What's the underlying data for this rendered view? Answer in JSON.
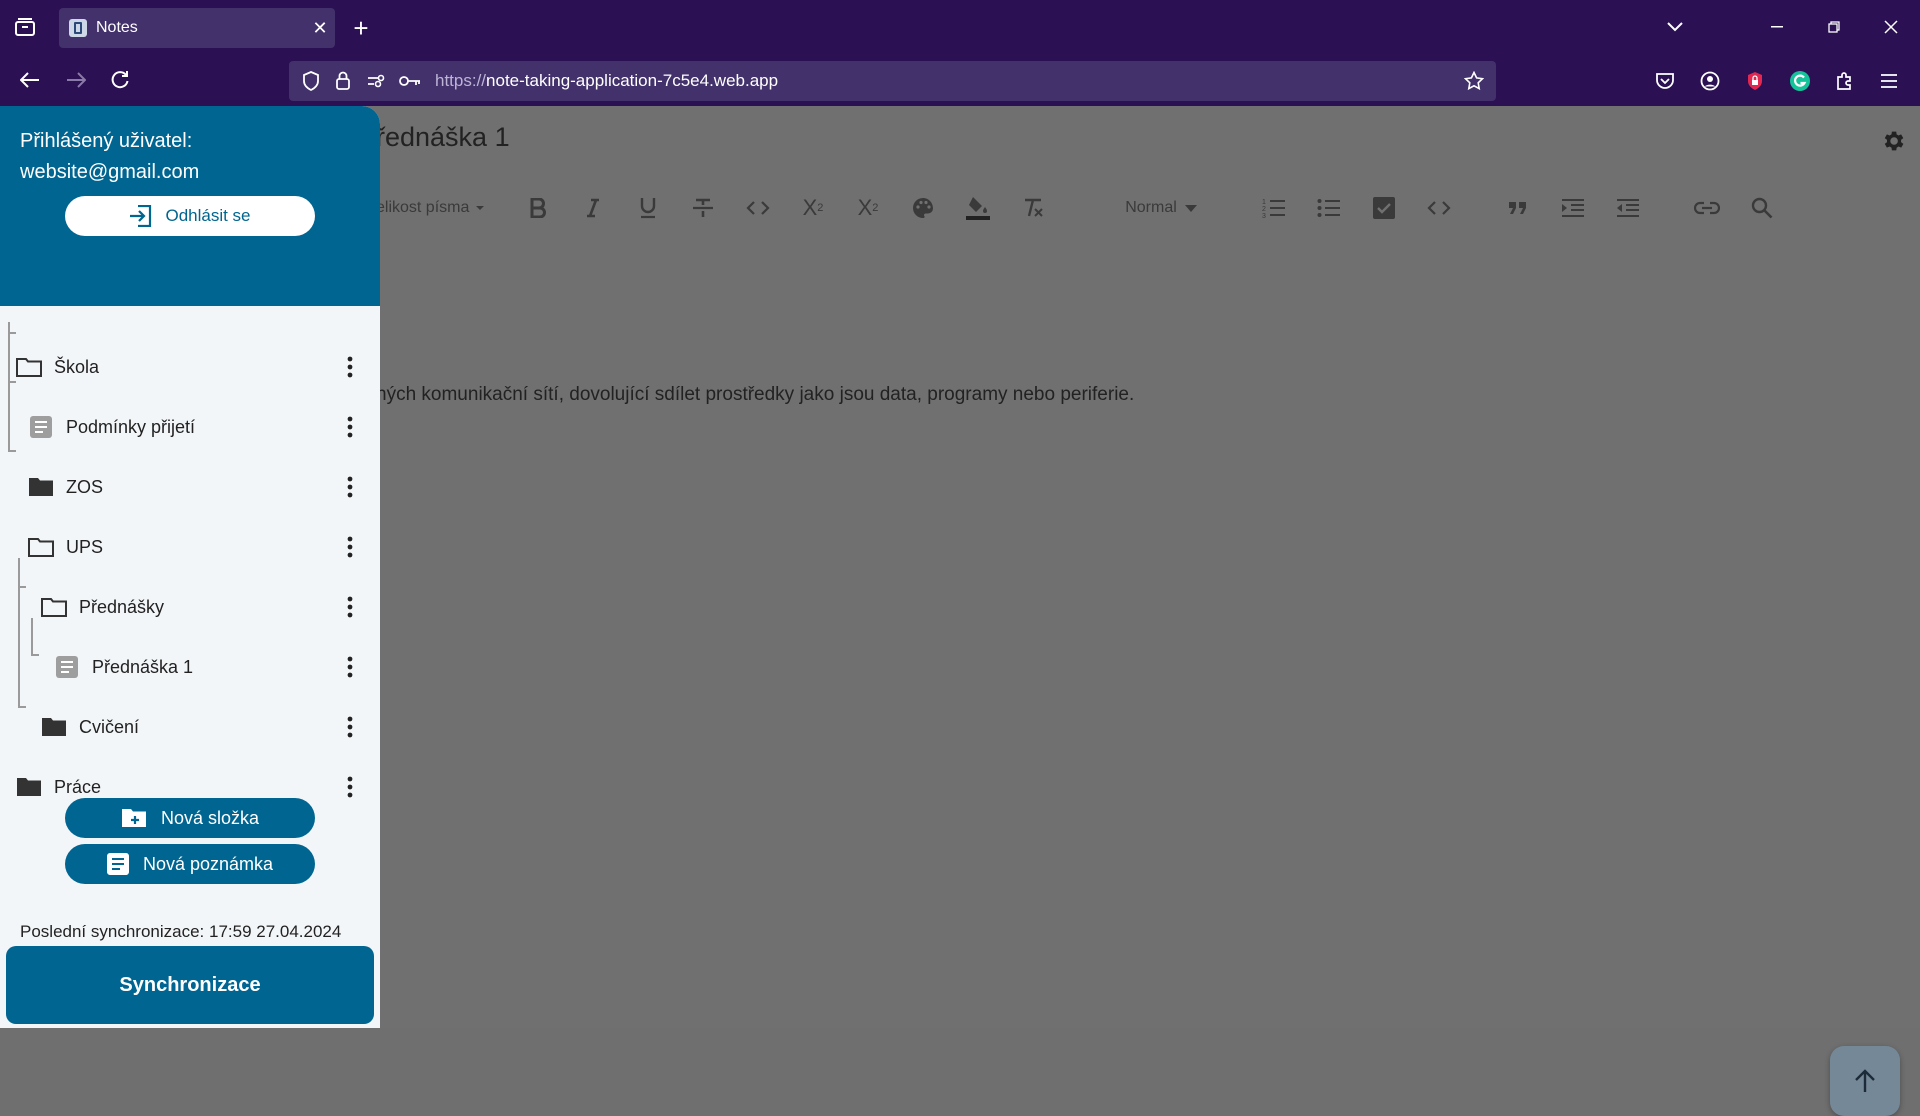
{
  "browser": {
    "tab_title": "Notes",
    "url_protocol": "https://",
    "url_host": "note-taking-application-7c5e4.web.app"
  },
  "sidebar": {
    "user_label": "Přihlášený uživatel:",
    "user_email": "website@gmail.com",
    "logout_label": "Odhlásit se",
    "tree": [
      {
        "label": "Škola",
        "type": "folder-open",
        "depth": 0
      },
      {
        "label": "Podmínky přijetí",
        "type": "note",
        "depth": 1
      },
      {
        "label": "ZOS",
        "type": "folder",
        "depth": 1
      },
      {
        "label": "UPS",
        "type": "folder-open",
        "depth": 1
      },
      {
        "label": "Přednášky",
        "type": "folder-open",
        "depth": 2
      },
      {
        "label": "Přednáška 1",
        "type": "note",
        "depth": 3
      },
      {
        "label": "Cvičení",
        "type": "folder",
        "depth": 2
      },
      {
        "label": "Práce",
        "type": "folder",
        "depth": 0
      }
    ],
    "new_folder_label": "Nová složka",
    "new_note_label": "Nová poznámka",
    "last_sync": "Poslední synchronizace: 17:59 27.04.2024",
    "sync_label": "Synchronizace"
  },
  "editor": {
    "title": "řednáška 1",
    "font_size_label": "elikost písma",
    "heading_select": "Normal",
    "body_text": "ných komunikační sítí, dovolující sdílet prostředky jako jsou data, programy nebo periferie."
  },
  "colors": {
    "primary": "#006591",
    "chrome": "#2b1053",
    "overlay": "#707070",
    "sidebar_bg": "#f3f6f9"
  }
}
